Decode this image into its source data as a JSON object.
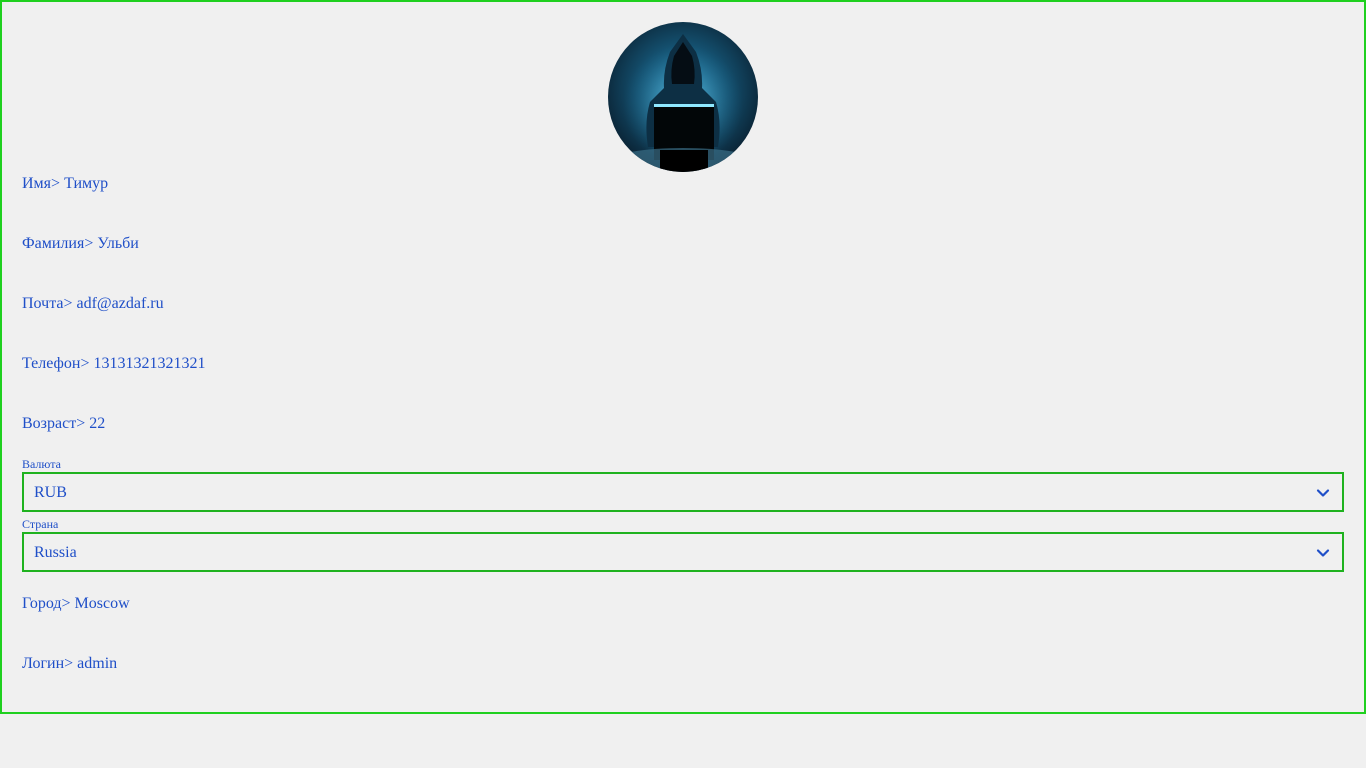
{
  "profile": {
    "avatar_icon": "hacker-avatar",
    "rows": [
      {
        "label": "Имя>",
        "value": "Тимур"
      },
      {
        "label": "Фамилия>",
        "value": "Ульби"
      },
      {
        "label": "Почта>",
        "value": "adf@azdaf.ru"
      },
      {
        "label": "Телефон>",
        "value": "13131321321321"
      },
      {
        "label": "Возраст>",
        "value": "22"
      }
    ],
    "currency": {
      "label": "Валюта",
      "value": "RUB",
      "icon": "chevron-down-icon"
    },
    "country": {
      "label": "Страна",
      "value": "Russia",
      "icon": "chevron-down-icon"
    },
    "city": {
      "label": "Город>",
      "value": "Moscow"
    },
    "login": {
      "label": "Логин>",
      "value": "admin"
    }
  },
  "colors": {
    "text": "#1f4fc8",
    "border": "#1fd01f",
    "background": "#f0f0f0"
  }
}
